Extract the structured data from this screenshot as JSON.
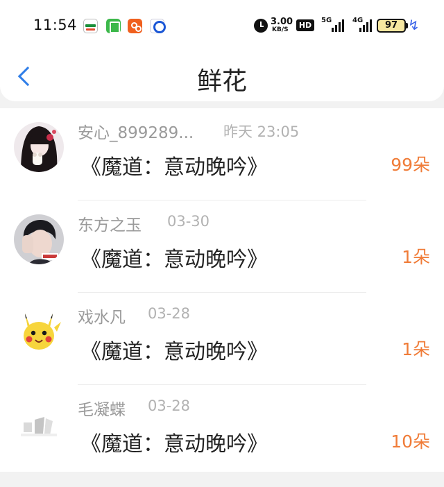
{
  "status_bar": {
    "time": "11:54",
    "net_speed": "3.00",
    "net_speed_unit": "KB/S",
    "hd_label": "HD",
    "network_5g": "5G",
    "network_4g": "4G",
    "battery": "97",
    "icons": [
      "oppo-app-icon",
      "green-app-icon",
      "orange-app-icon",
      "blue-app-icon",
      "alarm-icon",
      "signal-icon",
      "battery-icon",
      "charging-bolt-icon"
    ]
  },
  "header": {
    "title": "鲜花",
    "back_icon": "chevron-left-icon",
    "accent_color": "#2f7ee8"
  },
  "flower_records": [
    {
      "name": "安心_899289...",
      "date": "昨天 23:05",
      "title": "《魔道：意动晚吟》",
      "count": "99朵",
      "avatar": "girl-portrait"
    },
    {
      "name": "东方之玉",
      "date": "03-30",
      "title": "《魔道：意动晚吟》",
      "count": "1朵",
      "avatar": "boy-portrait"
    },
    {
      "name": "戏水凡",
      "date": "03-28",
      "title": "《魔道：意动晚吟》",
      "count": "1朵",
      "avatar": "pikachu"
    },
    {
      "name": "毛凝蝶",
      "date": "03-28",
      "title": "《魔道：意动晚吟》",
      "count": "10朵",
      "avatar": "faded-sketch"
    }
  ],
  "colors": {
    "count_color": "#f07c38",
    "name_color": "#9a9a9a",
    "title_color": "#222222"
  }
}
